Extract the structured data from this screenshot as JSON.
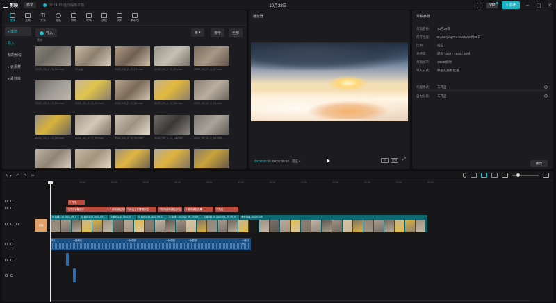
{
  "titlebar": {
    "app_name": "剪映",
    "menu": "菜单",
    "autosave": "09:14:13 自动保存本地",
    "title": "10月28日"
  },
  "tool_tabs": [
    {
      "label": "媒体",
      "icon": "media-icon",
      "active": true
    },
    {
      "label": "音频",
      "icon": "music-icon"
    },
    {
      "label": "文本",
      "icon": "text-icon"
    },
    {
      "label": "贴纸",
      "icon": "sticker-icon"
    },
    {
      "label": "特效",
      "icon": "effects-icon"
    },
    {
      "label": "转场",
      "icon": "transition-icon"
    },
    {
      "label": "滤镜",
      "icon": "filter-icon"
    },
    {
      "label": "调节",
      "icon": "adjust-icon"
    },
    {
      "label": "素材包",
      "icon": "package-icon"
    }
  ],
  "sidebar": {
    "items": [
      {
        "label": "▾ 本地",
        "active": true
      },
      {
        "label": "导入",
        "sub": true
      },
      {
        "label": "我的预设"
      },
      {
        "label": "▸ 云素材"
      },
      {
        "label": "▸ 素材库"
      }
    ]
  },
  "media": {
    "import_label": "导入",
    "sort_label": "排序",
    "all_label": "全部",
    "section": "素材",
    "items": [
      {
        "name": "2022_09_2...3_08.mov"
      },
      {
        "name": "33.jpg"
      },
      {
        "name": "2022_09_2...5_19.mov"
      },
      {
        "name": "2022_09_2...5_01.mov"
      },
      {
        "name": "2022_09_2...3_07.mov"
      },
      {
        "name": "2022_09_2...1_59.mov"
      },
      {
        "name": "2022_09_2...3_53.mov"
      },
      {
        "name": "2022_09_2...0_38.mov"
      },
      {
        "name": "2022_09_2...4_09.mov"
      },
      {
        "name": "2022_09_2...4_12.mov"
      },
      {
        "name": "2022_09_2...0_08.mov"
      },
      {
        "name": "2022_09_2...7_59.mov"
      },
      {
        "name": "2022_09_2...8_00.mov"
      },
      {
        "name": "2022_09_2...2_16.mov"
      },
      {
        "name": "2022_09_2...2_55.mov"
      },
      {
        "name": ""
      },
      {
        "name": ""
      },
      {
        "name": ""
      },
      {
        "name": ""
      },
      {
        "name": ""
      }
    ]
  },
  "player": {
    "title": "播放器",
    "time_current": "00:00:00:00",
    "time_total": "00:01:00:04",
    "quality": "适应 ▾",
    "ratio": "比例",
    "fullscreen": "⤢"
  },
  "props": {
    "title": "草稿参数",
    "rows": [
      {
        "k": "草稿名称:",
        "v": "10月28日"
      },
      {
        "k": "保存位置:",
        "v": "C:/JianyingPro Drafts/10月28日"
      },
      {
        "k": "比例:",
        "v": "适应"
      },
      {
        "k": "分辨率:",
        "v": "适应 1080 - 1920 / 30帧"
      },
      {
        "k": "草稿帧率:",
        "v": "30.00帧/秒"
      },
      {
        "k": "导入方式:",
        "v": "保留在原有位置"
      }
    ],
    "rows2": [
      {
        "k": "代理模式:",
        "v": "未开启"
      },
      {
        "k": "自由层级:",
        "v": "未开启"
      }
    ],
    "modify": "修改"
  },
  "timeline": {
    "ticks": [
      "00:00",
      "00:10",
      "00:20",
      "00:30",
      "00:40",
      "00:50",
      "01:00",
      "01:10",
      "01:20",
      "01:30",
      "01:40",
      "01:50",
      "02:00"
    ],
    "text_clips_top": [
      {
        "label": "T 开头"
      }
    ],
    "text_clips": [
      {
        "label": "T 开头字幕文字"
      },
      {
        "label": "T 瓷砖铺贴完成"
      },
      {
        "label": "T 清洁工作要做到位"
      },
      {
        "label": "T 现场瓷砖铺贴到位"
      },
      {
        "label": "T 瓷砖铺贴效果"
      },
      {
        "label": "T 完成"
      }
    ],
    "video_segments": [
      {
        "label": "◎ 曲线1.1X 2022_09_2"
      },
      {
        "label": "◎ 曲线1.1X 2022_09"
      },
      {
        "label": "◎ 曲线1.1X 2022_0"
      },
      {
        "label": "◎ 曲线1.1X 2022_09_2"
      },
      {
        "label": "◎ 曲线1.1X 2022_09_29_09"
      },
      {
        "label": "◎ 曲线1.1X 2022_09_29_09_54"
      },
      {
        "label": "黑色背景 2022/07/28"
      }
    ],
    "cover": "封面",
    "audio_labels": [
      "开头",
      "一段时光",
      "一段时光",
      "一段时光",
      "一段时光",
      "一段时光"
    ]
  },
  "colors": {
    "accent": "#19b7c6",
    "text_clip": "#b84a3e",
    "video_track": "#0b5e66",
    "audio_track": "#1b4f84"
  }
}
